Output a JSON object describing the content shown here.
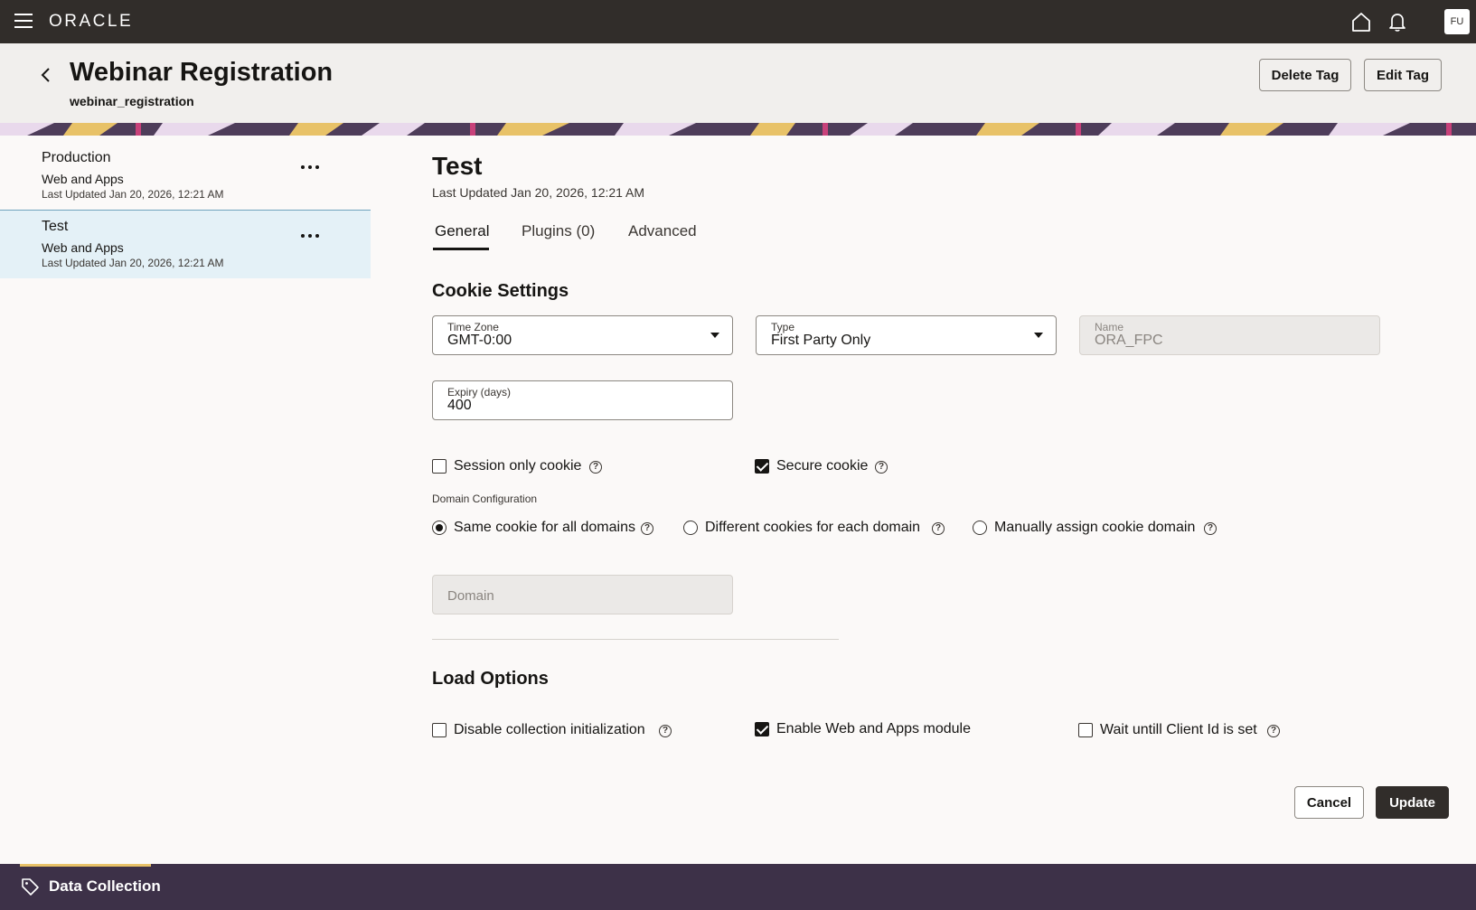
{
  "topbar": {
    "brand": "ORACLE",
    "avatar_initials": "FU",
    "icons": [
      "menu-icon",
      "home-icon",
      "bell-icon"
    ]
  },
  "header": {
    "title": "Webinar Registration",
    "subtitle": "webinar_registration",
    "delete_label": "Delete Tag",
    "edit_label": "Edit Tag"
  },
  "environments": [
    {
      "name": "Production",
      "type": "Web and Apps",
      "updated": "Last Updated Jan 20, 2026, 12:21 AM",
      "selected": false
    },
    {
      "name": "Test",
      "type": "Web and Apps",
      "updated": "Last Updated Jan 20, 2026, 12:21 AM",
      "selected": true
    }
  ],
  "main": {
    "title": "Test",
    "updated": "Last Updated Jan 20, 2026, 12:21 AM",
    "tabs": [
      {
        "label": "General",
        "active": true
      },
      {
        "label": "Plugins (0)",
        "active": false
      },
      {
        "label": "Advanced",
        "active": false
      }
    ]
  },
  "cookie_settings": {
    "title": "Cookie Settings",
    "time_zone": {
      "label": "Time Zone",
      "value": "GMT-0:00"
    },
    "type": {
      "label": "Type",
      "value": "First Party Only"
    },
    "name": {
      "label": "Name",
      "value": "ORA_FPC"
    },
    "expiry": {
      "label": "Expiry (days)",
      "value": "400"
    },
    "session_only": {
      "label": "Session only cookie",
      "checked": false
    },
    "secure": {
      "label": "Secure cookie",
      "checked": true
    },
    "domain_config_label": "Domain Configuration",
    "domain_options": [
      {
        "label": "Same cookie for all domains",
        "selected": true
      },
      {
        "label": "Different cookies for each domain",
        "selected": false
      },
      {
        "label": "Manually assign cookie domain",
        "selected": false
      }
    ],
    "domain_placeholder": "Domain"
  },
  "load_options": {
    "title": "Load Options",
    "disable_collection": {
      "label": "Disable collection initialization",
      "checked": false
    },
    "enable_web_apps": {
      "label": "Enable Web and Apps module",
      "checked": true
    },
    "wait_client_id": {
      "label": "Wait untill Client Id is set",
      "checked": false
    }
  },
  "actions": {
    "cancel_label": "Cancel",
    "update_label": "Update"
  },
  "footer": {
    "label": "Data Collection"
  },
  "colors": {
    "topbar": "#312d2a",
    "footer": "#3d3148",
    "selected_row": "#e4f1f7",
    "footer_accent": "#e8c268"
  }
}
